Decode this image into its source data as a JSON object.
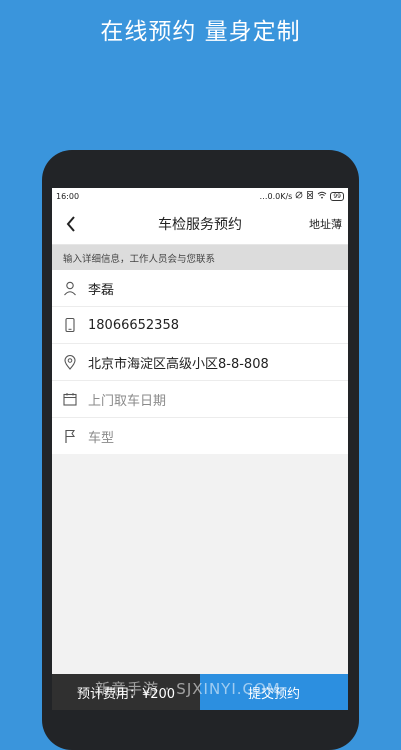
{
  "promo": {
    "title": "在线预约 量身定制"
  },
  "status": {
    "time": "16:00",
    "net": "…0.0K/s",
    "battery": "99"
  },
  "nav": {
    "title": "车检服务预约",
    "action": "地址薄"
  },
  "hint": "输入详细信息，工作人员会与您联系",
  "form": {
    "name": "李磊",
    "phone": "18066652358",
    "address": "北京市海淀区高级小区8-8-808",
    "date_placeholder": "上门取车日期",
    "model_placeholder": "车型"
  },
  "bottom": {
    "fee": "预计费用：¥200",
    "submit": "提交预约"
  },
  "watermark": "新意手游 · SJXINYI.COM",
  "colors": {
    "background": "#3a95dc",
    "submit": "#2c8fe0",
    "fee": "#303030"
  }
}
